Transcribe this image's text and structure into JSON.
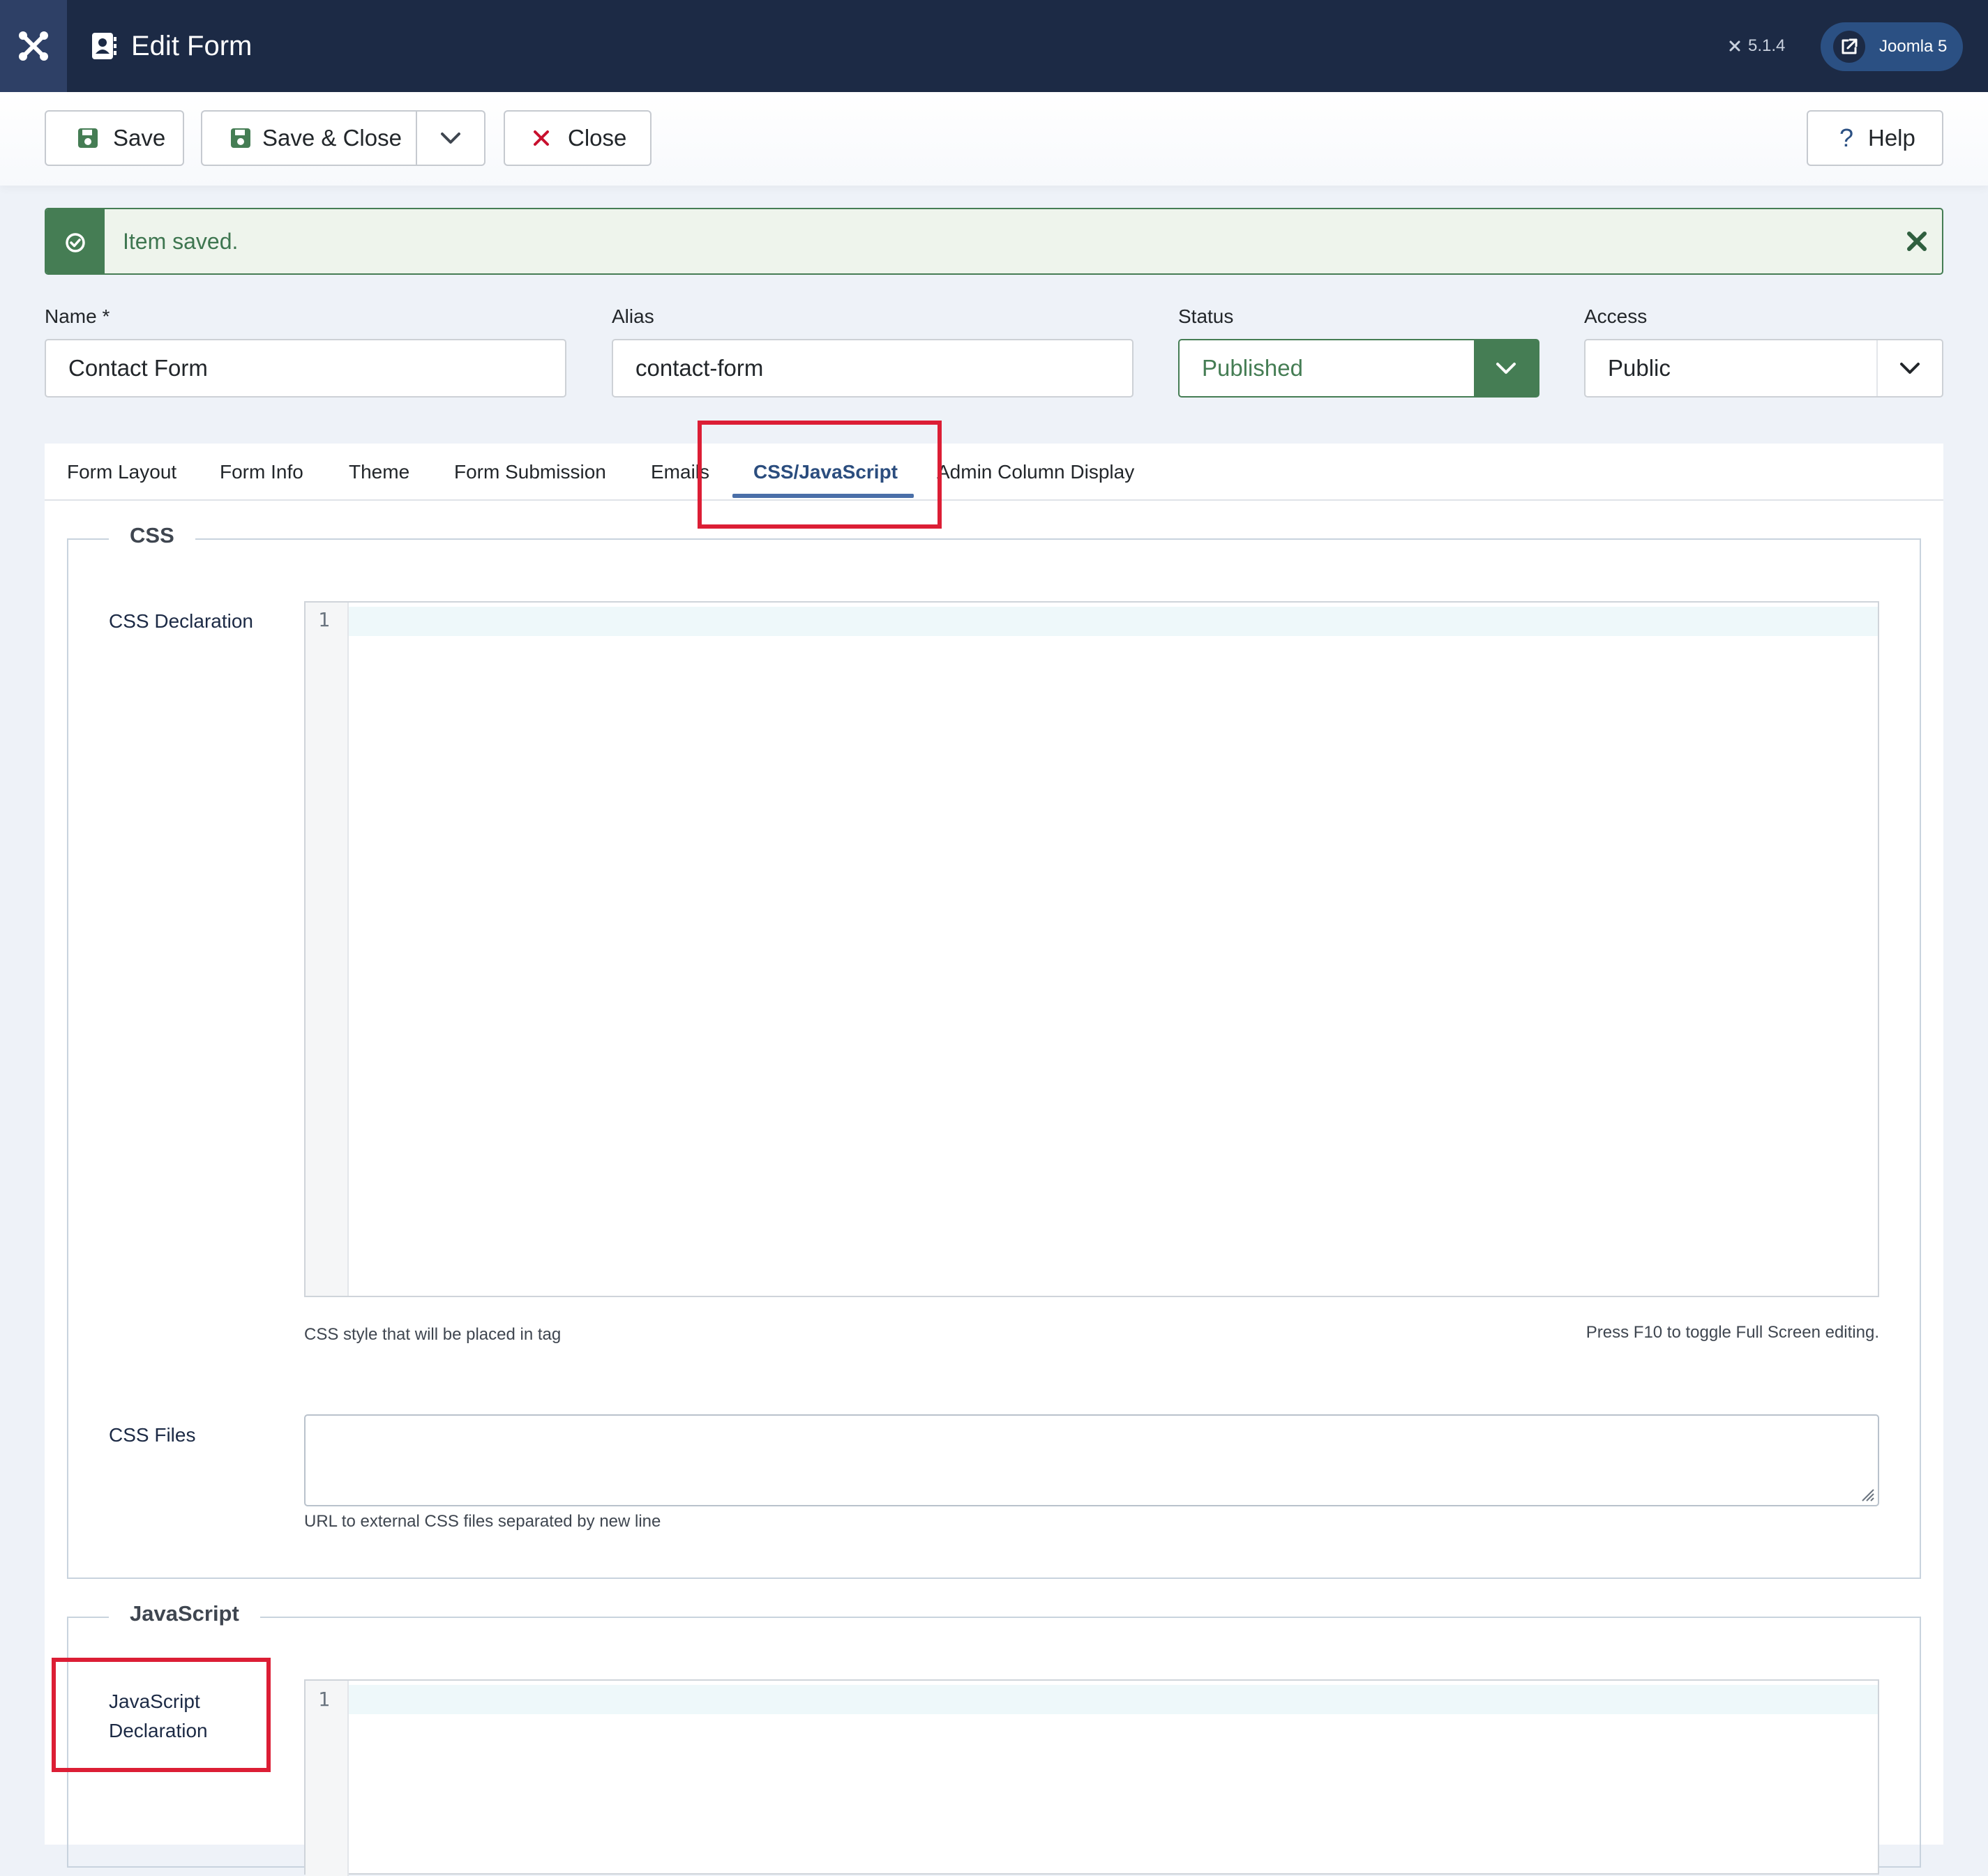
{
  "header": {
    "title": "Edit Form",
    "version": "5.1.4",
    "site_button_label": "Joomla 5"
  },
  "toolbar": {
    "save_label": "Save",
    "save_close_label": "Save & Close",
    "close_label": "Close",
    "help_label": "Help"
  },
  "alert": {
    "message": "Item saved."
  },
  "fields": {
    "name": {
      "label": "Name *",
      "value": "Contact Form"
    },
    "alias": {
      "label": "Alias",
      "value": "contact-form"
    },
    "status": {
      "label": "Status",
      "value": "Published"
    },
    "access": {
      "label": "Access",
      "value": "Public"
    }
  },
  "tabs": [
    {
      "label": "Form Layout"
    },
    {
      "label": "Form Info"
    },
    {
      "label": "Theme"
    },
    {
      "label": "Form Submission"
    },
    {
      "label": "Emails"
    },
    {
      "label": "CSS/JavaScript",
      "active": true
    },
    {
      "label": "Admin Column Display"
    }
  ],
  "css_section": {
    "legend": "CSS",
    "declaration_label": "CSS Declaration",
    "line_number": "1",
    "declaration_hint": "CSS style that will be placed in tag",
    "fullscreen_hint": "Press F10 to toggle Full Screen editing.",
    "files_label": "CSS Files",
    "files_hint": "URL to external CSS files separated by new line"
  },
  "js_section": {
    "legend": "JavaScript",
    "declaration_label_line1": "JavaScript",
    "declaration_label_line2": "Declaration",
    "line_number": "1"
  },
  "colors": {
    "header_bg": "#1c2a45",
    "success": "#457d54",
    "tab_active": "#2b4d7e",
    "annotation": "#dc1e35"
  }
}
